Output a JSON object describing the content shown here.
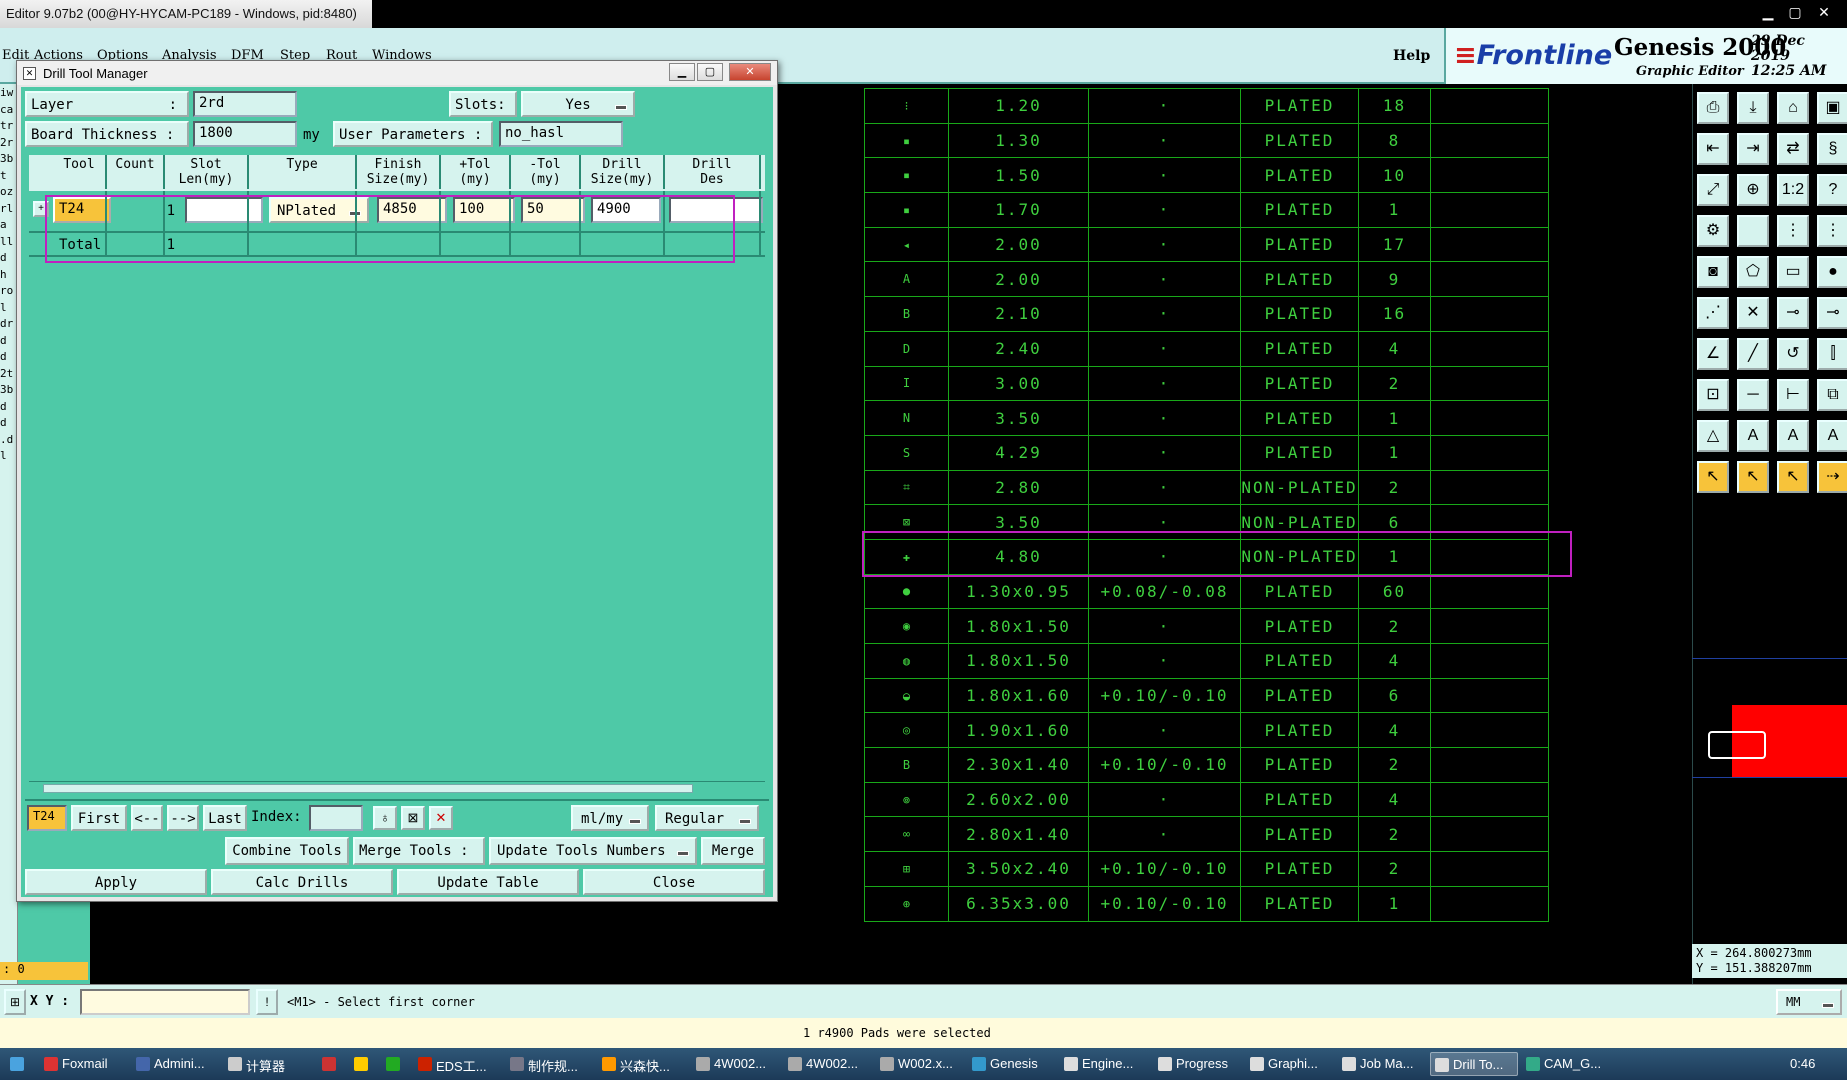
{
  "window": {
    "title": "Editor 9.07b2 (00@HY-HYCAM-PC189 - Windows, pid:8480)",
    "controls": [
      "▁",
      "▢",
      "✕"
    ]
  },
  "menubar": {
    "items": [
      "Edit",
      "Actions",
      "Options",
      "Analysis",
      "DFM",
      "Step",
      "Rout",
      "Windows"
    ],
    "help": "Help"
  },
  "brand": {
    "logo": "Frontline",
    "product": "Genesis 2000",
    "subtitle": "Graphic Editor",
    "date": "29 Dec 2019",
    "time": "12:25 AM"
  },
  "left_strip": {
    "labels": [
      "iw",
      "cal",
      "tr",
      "2r",
      "3b",
      "t",
      "oz",
      "rl",
      "a",
      "ll",
      "d",
      "h",
      "ro",
      "l",
      "dr",
      "d",
      "d",
      "2t",
      "3b",
      "d",
      "d",
      ".d",
      "l"
    ],
    "counter": ": 0"
  },
  "dialog": {
    "title": "Drill Tool Manager",
    "layer_label": "Layer",
    "layer_colon": ":",
    "layer_value": "2rd",
    "slots_label": "Slots:",
    "slots_value": "Yes",
    "board_thickness_label": "Board Thickness :",
    "board_thickness_value": "1800",
    "board_thickness_unit": "my",
    "user_params_label": "User Parameters :",
    "user_params_value": "no_hasl",
    "columns": [
      {
        "l1": "Tool",
        "l2": ""
      },
      {
        "l1": "Count",
        "l2": ""
      },
      {
        "l1": "Slot",
        "l2": "Len(my)"
      },
      {
        "l1": "Type",
        "l2": ""
      },
      {
        "l1": "Finish",
        "l2": "Size(my)"
      },
      {
        "l1": "+Tol",
        "l2": "(my)"
      },
      {
        "l1": "-Tol",
        "l2": "(my)"
      },
      {
        "l1": "Drill",
        "l2": "Size(my)"
      },
      {
        "l1": "Drill",
        "l2": "Des"
      }
    ],
    "row": {
      "tool": "T24",
      "count": "1",
      "slot_len": "",
      "type": "NPlated",
      "finish_size": "4850",
      "plus_tol": "100",
      "minus_tol": "50",
      "drill_size": "4900",
      "drill_des": ""
    },
    "total_label": "Total",
    "total_count": "1",
    "nav": {
      "current": "T24",
      "first": "First",
      "prev": "<--",
      "next": "-->",
      "last": "Last",
      "index_label": "Index:",
      "index_value": "",
      "units": "ml/my",
      "mode": "Regular"
    },
    "actions": {
      "combine": "Combine Tools",
      "merge_label": "Merge Tools :",
      "update_numbers": "Update Tools Numbers",
      "merge": "Merge",
      "apply": "Apply",
      "calc": "Calc Drills",
      "update_table": "Update Table",
      "close": "Close"
    }
  },
  "drill_table": [
    {
      "sym": "⁝",
      "size": "1.20",
      "tol": "·",
      "type": "PLATED",
      "count": "18"
    },
    {
      "sym": "▪",
      "size": "1.30",
      "tol": "·",
      "type": "PLATED",
      "count": "8"
    },
    {
      "sym": "▪",
      "size": "1.50",
      "tol": "·",
      "type": "PLATED",
      "count": "10"
    },
    {
      "sym": "▪",
      "size": "1.70",
      "tol": "·",
      "type": "PLATED",
      "count": "1"
    },
    {
      "sym": "◂",
      "size": "2.00",
      "tol": "·",
      "type": "PLATED",
      "count": "17"
    },
    {
      "sym": "A",
      "size": "2.00",
      "tol": "·",
      "type": "PLATED",
      "count": "9"
    },
    {
      "sym": "B",
      "size": "2.10",
      "tol": "·",
      "type": "PLATED",
      "count": "16"
    },
    {
      "sym": "D",
      "size": "2.40",
      "tol": "·",
      "type": "PLATED",
      "count": "4"
    },
    {
      "sym": "I",
      "size": "3.00",
      "tol": "·",
      "type": "PLATED",
      "count": "2"
    },
    {
      "sym": "N",
      "size": "3.50",
      "tol": "·",
      "type": "PLATED",
      "count": "1"
    },
    {
      "sym": "S",
      "size": "4.29",
      "tol": "·",
      "type": "PLATED",
      "count": "1"
    },
    {
      "sym": "⌗",
      "size": "2.80",
      "tol": "·",
      "type": "NON-PLATED",
      "count": "2"
    },
    {
      "sym": "⊠",
      "size": "3.50",
      "tol": "·",
      "type": "NON-PLATED",
      "count": "6"
    },
    {
      "sym": "✚",
      "size": "4.80",
      "tol": "·",
      "type": "NON-PLATED",
      "count": "1"
    },
    {
      "sym": "●",
      "size": "1.30x0.95",
      "tol": "+0.08/-0.08",
      "type": "PLATED",
      "count": "60"
    },
    {
      "sym": "◉",
      "size": "1.80x1.50",
      "tol": "·",
      "type": "PLATED",
      "count": "2"
    },
    {
      "sym": "◍",
      "size": "1.80x1.50",
      "tol": "·",
      "type": "PLATED",
      "count": "4"
    },
    {
      "sym": "◒",
      "size": "1.80x1.60",
      "tol": "+0.10/-0.10",
      "type": "PLATED",
      "count": "6"
    },
    {
      "sym": "◎",
      "size": "1.90x1.60",
      "tol": "·",
      "type": "PLATED",
      "count": "4"
    },
    {
      "sym": "B",
      "size": "2.30x1.40",
      "tol": "+0.10/-0.10",
      "type": "PLATED",
      "count": "2"
    },
    {
      "sym": "⊚",
      "size": "2.60x2.00",
      "tol": "·",
      "type": "PLATED",
      "count": "4"
    },
    {
      "sym": "∞",
      "size": "2.80x1.40",
      "tol": "·",
      "type": "PLATED",
      "count": "2"
    },
    {
      "sym": "⊞",
      "size": "3.50x2.40",
      "tol": "+0.10/-0.10",
      "type": "PLATED",
      "count": "2"
    },
    {
      "sym": "⊕",
      "size": "6.35x3.00",
      "tol": "+0.10/-0.10",
      "type": "PLATED",
      "count": "1"
    }
  ],
  "right_panel": {
    "coords_x": "X = 264.800273mm",
    "coords_y": "Y = 151.388207mm",
    "tool_icons": [
      "snapshot-icon",
      "save-icon",
      "home-icon",
      "window-icon",
      "zoom-prev-icon",
      "zoom-next-icon",
      "zoom-out-icon",
      "split-icon",
      "fit-icon",
      "center-icon",
      "ratio-icon",
      "help-icon",
      "grid-icon",
      "blank-icon",
      "drill-icon",
      "drill2-icon",
      "camera-icon",
      "route-icon",
      "ruler-icon",
      "circle-icon",
      "node-icon",
      "cross-icon",
      "link-icon",
      "pin-icon",
      "angle-icon",
      "line-icon",
      "arc-icon",
      "split2-icon",
      "add-icon",
      "minus-icon",
      "measure-icon",
      "copy-icon",
      "triangle-icon",
      "a-icon",
      "a2-icon",
      "a3-icon",
      "pointer-icon",
      "pointer2-icon",
      "pointer3-icon",
      "route2-icon"
    ],
    "tool_glyphs": [
      "⎙",
      "⤓",
      "⌂",
      "▣",
      "⇤",
      "⇥",
      "⇄",
      "§",
      "⤢",
      "⊕",
      "1:2",
      "?",
      "⚙",
      "",
      "⋮",
      "⋮",
      "◙",
      "⬠",
      "▭",
      "●",
      "⋰",
      "✕",
      "⊸",
      "⊸",
      "∠",
      "╱",
      "↺",
      "⫿",
      "⊡",
      "─",
      "⊢",
      "⧉",
      "△",
      "A",
      "A",
      "A",
      "↖",
      "↖",
      "↖",
      "⇢"
    ]
  },
  "command": {
    "xy_label": "X Y :",
    "xy_value": "",
    "prompt": "<M1> - Select first corner",
    "units": "MM",
    "status": "1 r4900 Pads were selected"
  },
  "taskbar": {
    "items": [
      "Foxmail",
      "Admini...",
      "计算器",
      "",
      "",
      "",
      "EDS工...",
      "制作规...",
      "兴森快...",
      "4W002...",
      "4W002...",
      "W002.x...",
      "Genesis",
      "Engine...",
      "Progress",
      "Graphi...",
      "Job Ma...",
      "Drill To...",
      "CAM_G..."
    ],
    "clock": "0:46"
  },
  "colors": {
    "teal": "#4ec9a7",
    "light_teal": "#d6f3ee",
    "table_green": "#3fcf3f",
    "highlight_magenta": "#c020c0",
    "selected_tool": "#f7c33a"
  }
}
